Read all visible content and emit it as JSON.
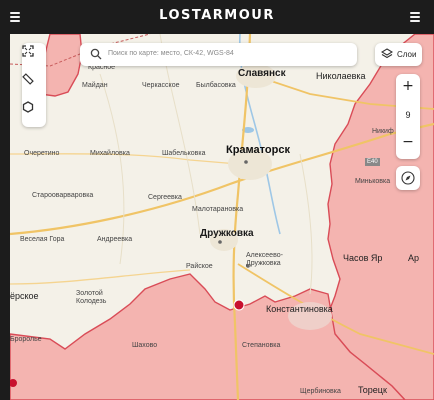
{
  "header": {
    "logo": "LOSTARMOUR",
    "menu_left_icon": "hamburger-icon",
    "menu_right_icon": "hamburger-icon"
  },
  "search": {
    "placeholder": "Поиск по карте: место, СК-42, WGS-84"
  },
  "layers": {
    "label": "Слои"
  },
  "zoom": {
    "level": "9",
    "plus": "+",
    "minus": "−"
  },
  "colors": {
    "occupied": "#f4b4b0",
    "frontline": "#d94c57",
    "map_bg": "#f4f1e8",
    "road": "#f0c466",
    "water": "#9ec7e6"
  },
  "places": {
    "slavyansk": "Славянск",
    "nikolaevka": "Николаевка",
    "kramatorsk": "Краматорск",
    "druzhkovka": "Дружковка",
    "konstantinovka": "Константиновка",
    "krasnoe": "Красное",
    "maydan": "Майдан",
    "cherkasskoe": "Черкасское",
    "bylbasovka": "Былбасовка",
    "ocheretino": "Очеретино",
    "mikhaylovka": "Михайловка",
    "shabelkovka": "Шабельковка",
    "starovarvarovka": "Старооварваровка",
    "sergeevka": "Сергеевка",
    "malotaranovka": "Малотарановка",
    "veselaya_gora": "Веселая Гора",
    "andreevka": "Андреевка",
    "rayskoe": "Райское",
    "alekseevo": "Алексеево-\nДружковка",
    "chasov_yar": "Часов Яр",
    "minkovka": "Миньковка",
    "nikif": "Никиф",
    "ap": "Ар",
    "erskoe": "ёрское",
    "zolotoy": "Золотой\nКолодезь",
    "bropolye": "Броpолье",
    "shakhovo": "Шахово",
    "stepanovka": "Степановка",
    "toretsk": "Торецк",
    "shcherbinovka": "Щербиновка",
    "road_e40": "E40"
  }
}
